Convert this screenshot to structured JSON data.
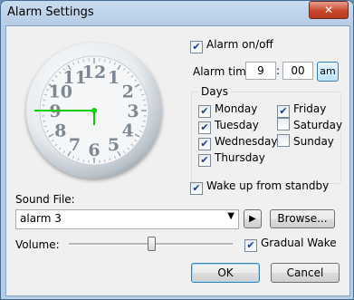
{
  "window": {
    "title": "Alarm Settings",
    "close_glyph": "✕"
  },
  "clock": {
    "numerals": [
      "12",
      "1",
      "2",
      "3",
      "4",
      "5",
      "6",
      "7",
      "8",
      "9",
      "10",
      "11"
    ],
    "time": {
      "hour": 9,
      "minute": 0
    },
    "hand_color": "#00cc00"
  },
  "alarm_on": {
    "label": "Alarm on/off",
    "checked": true
  },
  "alarm_time": {
    "label": "Alarm time:",
    "hour": "9",
    "separator": ":",
    "minute": "00",
    "ampm": "am"
  },
  "days": {
    "title": "Days",
    "items": [
      {
        "label": "Monday",
        "checked": true
      },
      {
        "label": "Tuesday",
        "checked": true
      },
      {
        "label": "Wednesday",
        "checked": true
      },
      {
        "label": "Thursday",
        "checked": true
      },
      {
        "label": "Friday",
        "checked": true
      },
      {
        "label": "Saturday",
        "checked": false
      },
      {
        "label": "Sunday",
        "checked": false
      }
    ]
  },
  "wake_standby": {
    "label": "Wake up from standby",
    "checked": true
  },
  "sound": {
    "label": "Sound File:",
    "value": "alarm 3",
    "play_icon": "▶",
    "browse_label": "Browse..."
  },
  "volume": {
    "label": "Volume:",
    "level": 0.5
  },
  "gradual_wake": {
    "label": "Gradual Wake",
    "checked": true
  },
  "buttons": {
    "ok": "OK",
    "cancel": "Cancel"
  },
  "check_glyph": "✔",
  "dropdown_glyph": "▼"
}
